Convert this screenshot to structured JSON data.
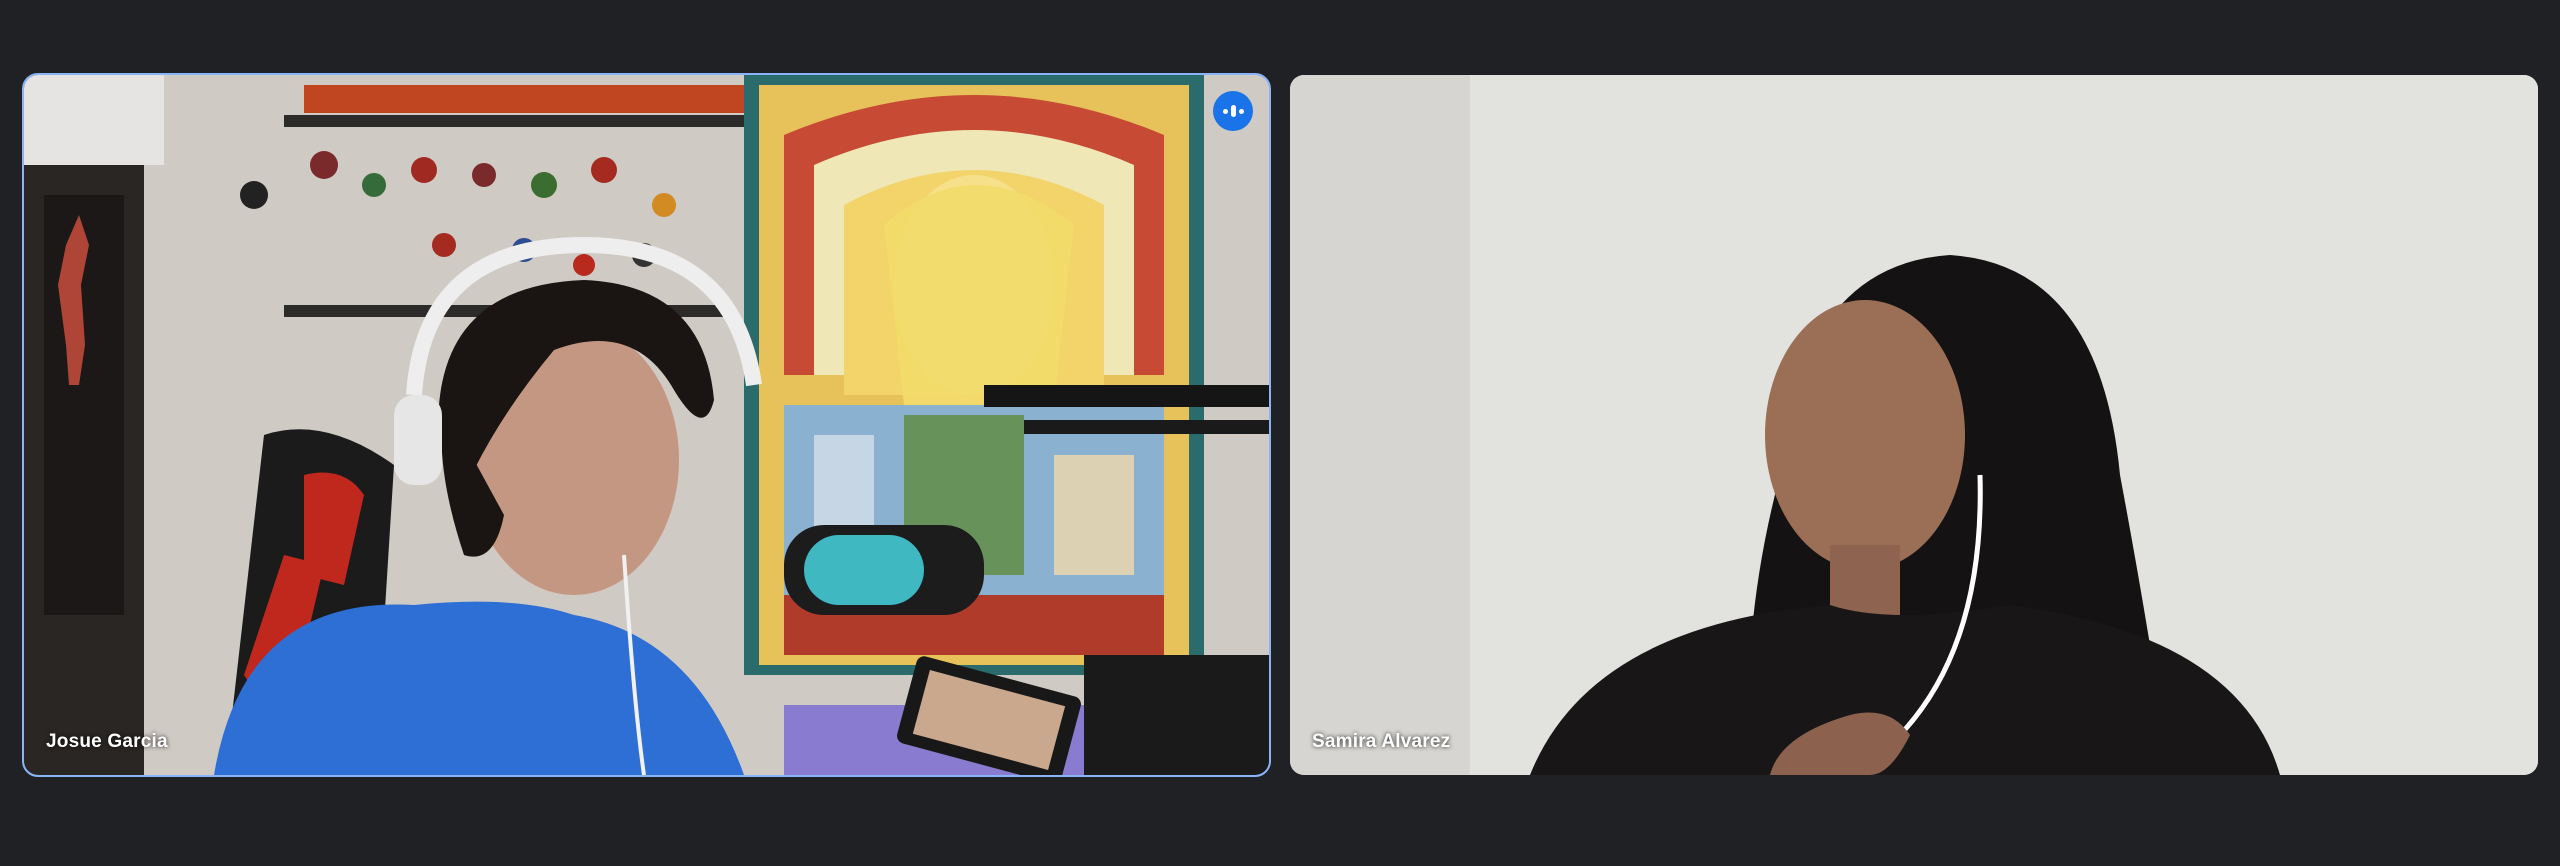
{
  "participants": [
    {
      "name": "Josue Garcia",
      "speaking": true,
      "active_speaker_color": "#8ab4f8",
      "indicator_icon": "audio-level-icon"
    },
    {
      "name": "Samira Alvarez",
      "speaking": false
    }
  ],
  "colors": {
    "background": "#202124",
    "tile_highlight": "#8ab4f8",
    "indicator": "#1a73e8"
  }
}
